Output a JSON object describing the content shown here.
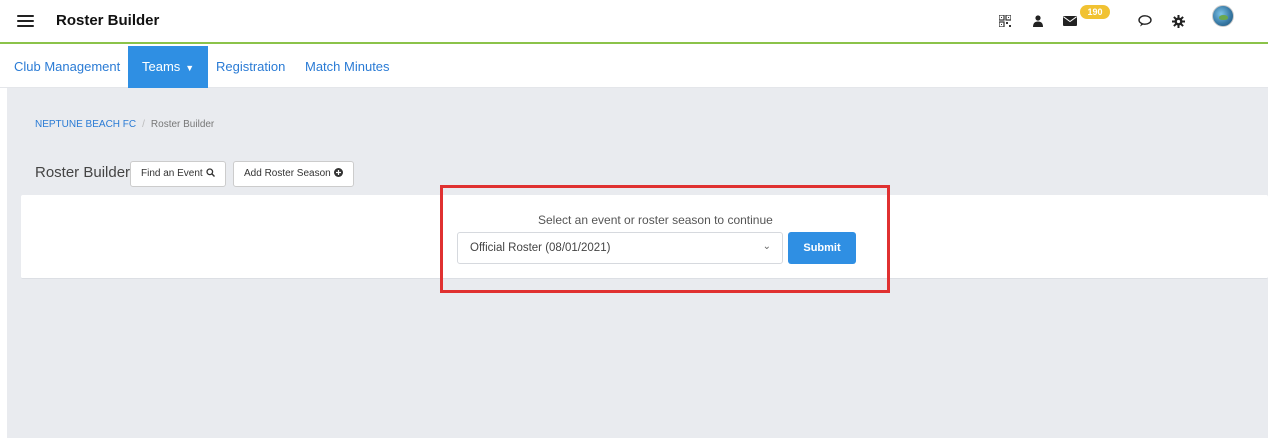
{
  "header": {
    "app_title": "Roster Builder",
    "icons": [
      "menu-icon",
      "qr-code-icon",
      "user-icon",
      "mail-icon",
      "chat-icon",
      "gear-icon",
      "club-logo-avatar"
    ],
    "mail_badge": "190"
  },
  "nav": {
    "items": [
      {
        "label": "Club Management"
      },
      {
        "label": "Teams"
      },
      {
        "label": "Registration"
      },
      {
        "label": "Match Minutes"
      }
    ],
    "active": "Teams",
    "active_color": "#2f8fe3"
  },
  "breadcrumb": {
    "club": "NEPTUNE BEACH FC",
    "separator": "/",
    "current": "Roster Builder"
  },
  "page": {
    "title": "Roster Builder",
    "find_event_label": "Find an Event",
    "add_season_label": "Add Roster Season"
  },
  "selector": {
    "prompt": "Select an event or roster season to continue",
    "selected_value": "Official Roster (08/01/2021)",
    "submit_label": "Submit"
  },
  "colors": {
    "accent": "#2f8fe3",
    "highlight": "#e03131",
    "badge": "#f1c232",
    "topbar_border": "#8bc34a"
  }
}
